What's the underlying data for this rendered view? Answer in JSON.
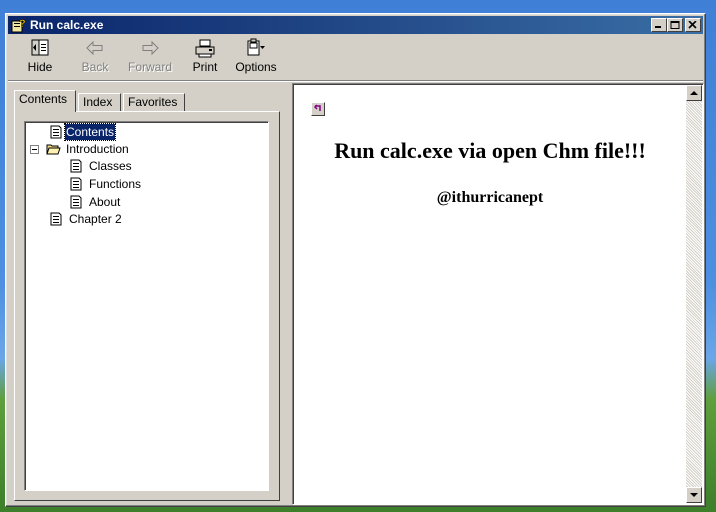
{
  "window": {
    "title": "Run calc.exe"
  },
  "toolbar": {
    "hide": "Hide",
    "back": "Back",
    "forward": "Forward",
    "print": "Print",
    "options": "Options"
  },
  "tabs": [
    {
      "label": "Contents"
    },
    {
      "label": "Index"
    },
    {
      "label": "Favorites"
    }
  ],
  "tree": {
    "contents": "Contents",
    "introduction": "Introduction",
    "classes": "Classes",
    "functions": "Functions",
    "about": "About",
    "chapter2": "Chapter 2"
  },
  "content": {
    "heading": "Run calc.exe via open Chm file!!!",
    "author": "@ithurricanept"
  },
  "colors": {
    "titlebar_start": "#0a246a",
    "titlebar_end": "#3a6ea5",
    "selection": "#0a246a",
    "chrome": "#d4d0c8"
  }
}
